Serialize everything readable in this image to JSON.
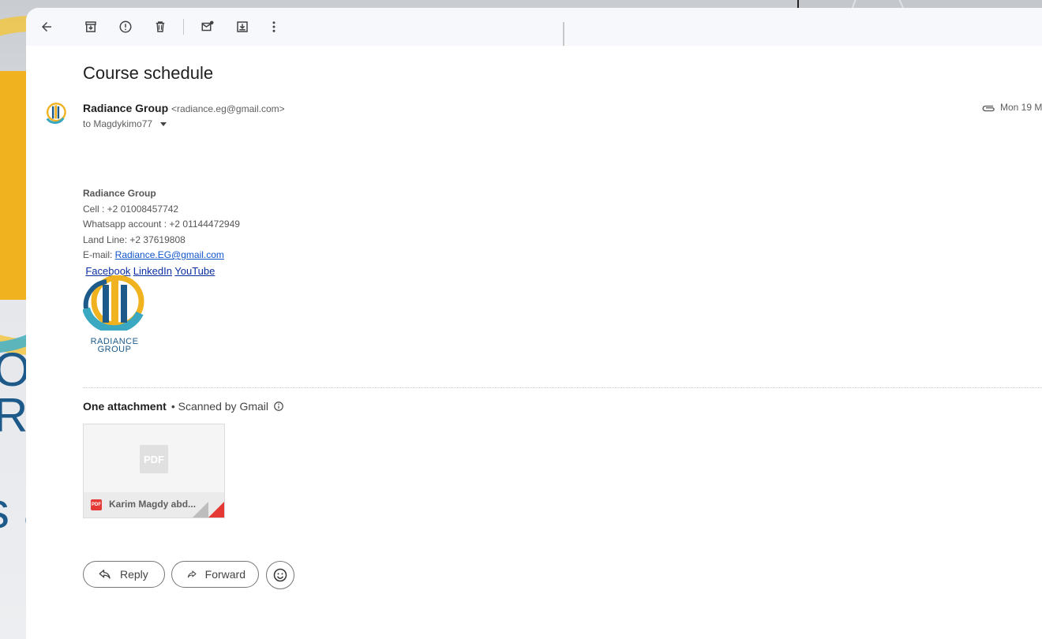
{
  "toolbar": {
    "icons": [
      "back-arrow-icon",
      "archive-icon",
      "report-spam-icon",
      "delete-icon",
      "mark-unread-icon",
      "move-to-icon",
      "more-vert-icon"
    ]
  },
  "email": {
    "subject": "Course schedule",
    "sender_name": "Radiance Group",
    "sender_email": "<radiance.eg@gmail.com>",
    "to": "to Magdykimo77",
    "date": "Mon 19 M"
  },
  "signature": {
    "name": "Radiance Group",
    "cell": "Cell : +2 01008457742",
    "whatsapp": "Whatsapp account : +2 01144472949",
    "landline": "Land Line: +2 37619808",
    "email_label": "E-mail: ",
    "email_link": "Radiance.EG@gmail.com",
    "links": {
      "facebook": "Facebook",
      "linkedin": "LinkedIn",
      "youtube": "YouTube "
    },
    "logo_text_line1": "RADIANCE",
    "logo_text_line2": "GROUP"
  },
  "attachments": {
    "title": "One attachment",
    "scanned": "• Scanned by Gmail",
    "file_name": "Karim Magdy abd...",
    "file_type": "PDF",
    "file_type_small": "PDF"
  },
  "actions": {
    "reply": "Reply",
    "forward": "Forward"
  },
  "colors": {
    "link": "#1155cc",
    "pdf_red": "#e53935",
    "toolbar_bg": "#f6f8fc",
    "brand_yellow": "#f0b21f",
    "brand_blue": "#1d5a8a"
  }
}
